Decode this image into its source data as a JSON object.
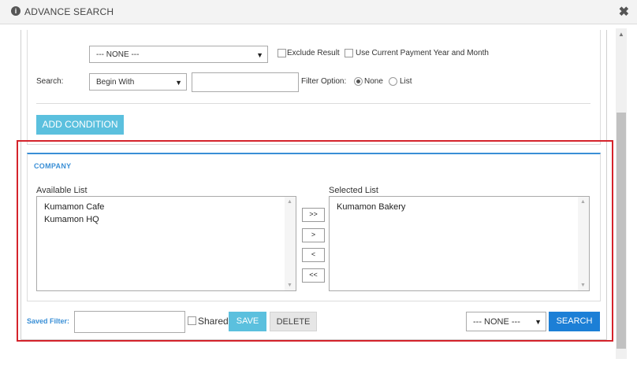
{
  "dialog": {
    "title": "ADVANCE SEARCH",
    "info_icon": "i",
    "close_icon": "✖"
  },
  "condition": {
    "field_select": "--- NONE ---",
    "exclude_result_label": "Exclude Result",
    "use_payment_label": "Use Current Payment Year and Month",
    "search_label": "Search:",
    "search_mode_select": "Begin With",
    "search_value": "",
    "filter_option_label": "Filter Option:",
    "filter_none_label": "None",
    "filter_list_label": "List",
    "add_condition_label": "ADD CONDITION"
  },
  "company": {
    "title": "COMPANY",
    "available_label": "Available List",
    "available_items": [
      "Kumamon Cafe",
      "Kumamon HQ"
    ],
    "selected_label": "Selected List",
    "selected_items": [
      "Kumamon Bakery"
    ],
    "move_all_right": ">>",
    "move_right": ">",
    "move_left": "<",
    "move_all_left": "<<"
  },
  "footer": {
    "saved_filter_label": "Saved Filter:",
    "saved_filter_value": "",
    "shared_label": "Shared",
    "save_label": "SAVE",
    "delete_label": "DELETE",
    "saved_select": "--- NONE ---",
    "search_label": "SEARCH"
  },
  "colors": {
    "accent_light": "#5bc0de",
    "accent_blue": "#1c7fd6",
    "highlight_red": "#d4232b"
  }
}
